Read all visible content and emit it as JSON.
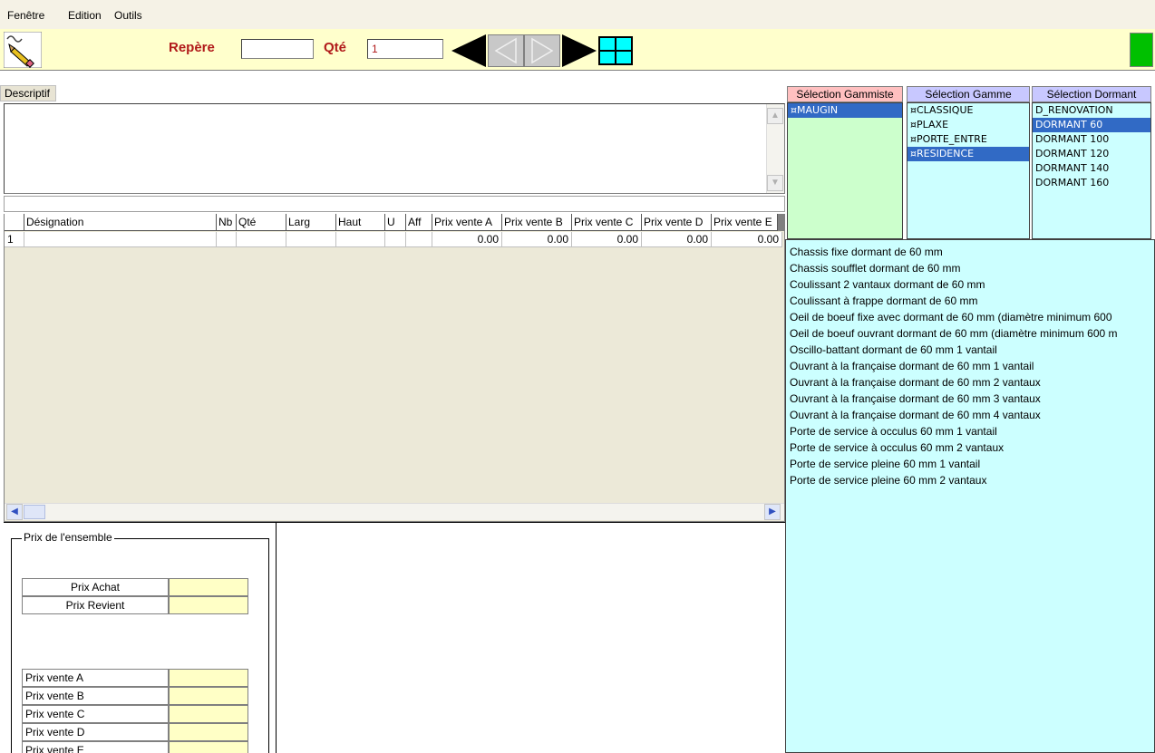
{
  "menu": {
    "items": [
      "Fenêtre",
      "Edition",
      "Outils"
    ]
  },
  "toolbar": {
    "repere_label": "Repère",
    "repere_value": "",
    "qte_label": "Qté",
    "qte_value": "1"
  },
  "descriptif": {
    "label": "Descriptif",
    "text": ""
  },
  "grid": {
    "columns": [
      "",
      "Désignation",
      "Nb",
      "Qté",
      "Larg",
      "Haut",
      "U",
      "Aff",
      "Prix vente A",
      "Prix vente B",
      "Prix vente C",
      "Prix vente D",
      "Prix vente E"
    ],
    "rows": [
      [
        "1",
        "",
        "",
        "",
        "",
        "",
        "",
        "",
        "0.00",
        "0.00",
        "0.00",
        "0.00",
        "0.00"
      ]
    ]
  },
  "pricing": {
    "group_title": "Prix de l'ensemble",
    "rows_top": [
      "Prix Achat",
      "Prix Revient"
    ],
    "rows_bottom": [
      "Prix vente A",
      "Prix vente B",
      "Prix vente C",
      "Prix vente D",
      "Prix vente E"
    ]
  },
  "selection": {
    "gammiste": {
      "header": "Sélection Gammiste",
      "items": [
        "¤MAUGIN"
      ],
      "selected_index": 0
    },
    "gamme": {
      "header": "Sélection Gamme",
      "items": [
        "¤CLASSIQUE",
        "¤PLAXE",
        "¤PORTE_ENTRE",
        "¤RESIDENCE"
      ],
      "selected_index": 3
    },
    "dormant": {
      "header": "Sélection Dormant",
      "items": [
        "D_RENOVATION",
        "DORMANT  60",
        "DORMANT 100",
        "DORMANT 120",
        "DORMANT 140",
        "DORMANT 160"
      ],
      "selected_index": 1
    }
  },
  "dormant_types": [
    "Chassis fixe dormant de 60 mm",
    "Chassis soufflet dormant de 60 mm",
    "Coulissant 2 vantaux dormant de 60 mm",
    "Coulissant à frappe dormant de 60 mm",
    "Oeil de boeuf fixe avec dormant de 60 mm (diamètre minimum 600",
    "Oeil de boeuf ouvrant dormant de 60 mm (diamètre minimum 600 m",
    "Oscillo-battant dormant de 60 mm 1 vantail",
    "Ouvrant à la française dormant de 60 mm 1 vantail",
    "Ouvrant à la française dormant de 60 mm 2 vantaux",
    "Ouvrant à la française dormant de 60 mm 3 vantaux",
    "Ouvrant à la française dormant de 60 mm 4 vantaux",
    "Porte de service à occulus 60 mm 1 vantail",
    "Porte de service à occulus 60 mm 2 vantaux",
    "Porte de service pleine 60 mm 1 vantail",
    "Porte de service pleine 60 mm 2 vantaux"
  ],
  "colors": {
    "toolbar_bg": "#ffffcc",
    "label_red": "#b11a1a",
    "gammiste_bg": "#ccffcc",
    "gammiste_head": "#ffc0c0",
    "gamme_head": "#c8c8ff",
    "cyan_bg": "#ccffff",
    "selection_blue": "#316ac5",
    "price_yellow": "#ffffc6",
    "status_green": "#00c000"
  },
  "icons": [
    "app-pencil-icon",
    "first-record-icon",
    "previous-icon",
    "next-icon",
    "last-record-icon",
    "grid-view-icon",
    "status-indicator-icon"
  ]
}
